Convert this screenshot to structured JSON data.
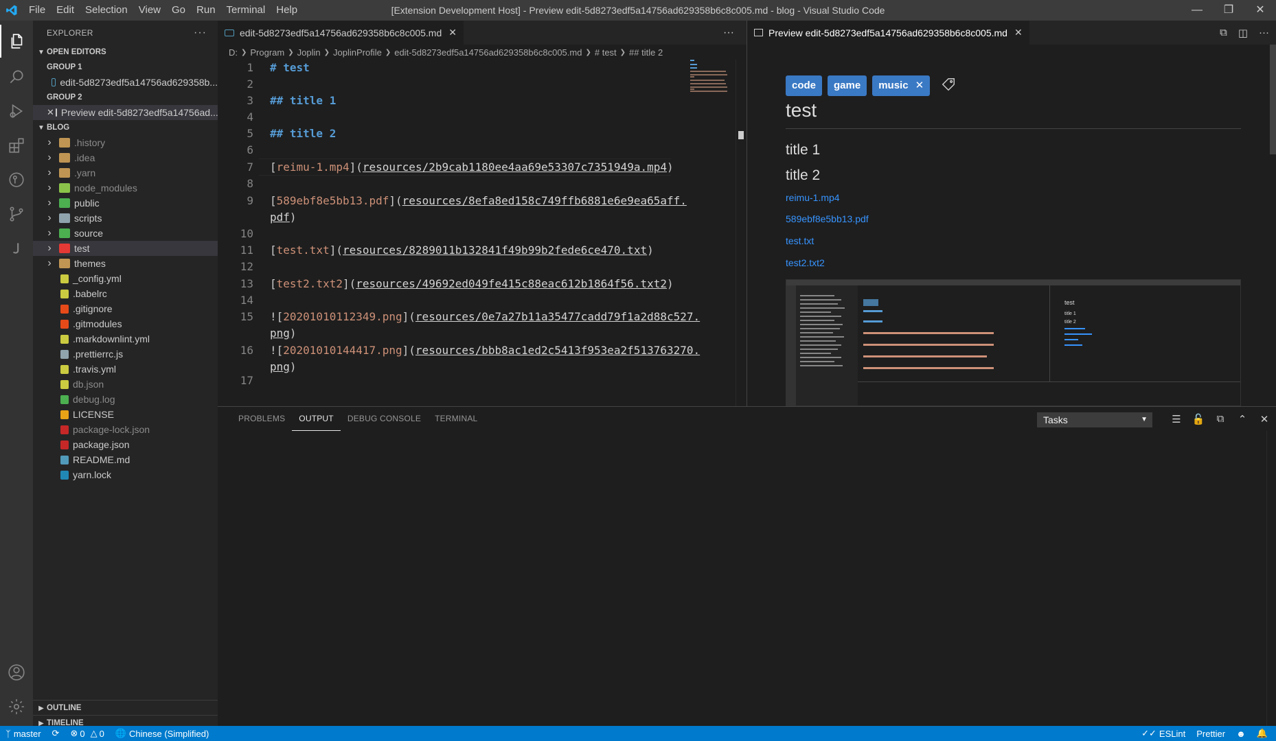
{
  "window": {
    "title": "[Extension Development Host] - Preview edit-5d8273edf5a14756ad629358b6c8c005.md - blog - Visual Studio Code",
    "menu": [
      "File",
      "Edit",
      "Selection",
      "View",
      "Go",
      "Run",
      "Terminal",
      "Help"
    ]
  },
  "sidebar": {
    "title": "EXPLORER",
    "open_editors": {
      "label": "OPEN EDITORS",
      "group1_label": "GROUP 1",
      "group1_item": "edit-5d8273edf5a14756ad629358b...",
      "group2_label": "GROUP 2",
      "group2_item": "Preview edit-5d8273edf5a14756ad..."
    },
    "folder_label": "BLOG",
    "tree": [
      {
        "name": ".history",
        "type": "folder",
        "color": "#c09553"
      },
      {
        "name": ".idea",
        "type": "folder",
        "color": "#c09553"
      },
      {
        "name": ".yarn",
        "type": "folder",
        "color": "#c09553"
      },
      {
        "name": "node_modules",
        "type": "folder",
        "color": "#8bc34a"
      },
      {
        "name": "public",
        "type": "folder",
        "color": "#4caf50"
      },
      {
        "name": "scripts",
        "type": "folder",
        "color": "#90a4ae"
      },
      {
        "name": "source",
        "type": "folder",
        "color": "#4caf50"
      },
      {
        "name": "test",
        "type": "folder",
        "color": "#e53935"
      },
      {
        "name": "themes",
        "type": "folder",
        "color": "#c09553"
      },
      {
        "name": "_config.yml",
        "type": "file",
        "color": "#cbcb41"
      },
      {
        "name": ".babelrc",
        "type": "file",
        "color": "#cbcb41"
      },
      {
        "name": ".gitignore",
        "type": "file",
        "color": "#e64a19"
      },
      {
        "name": ".gitmodules",
        "type": "file",
        "color": "#e64a19"
      },
      {
        "name": ".markdownlint.yml",
        "type": "file",
        "color": "#cbcb41"
      },
      {
        "name": ".prettierrc.js",
        "type": "file",
        "color": "#90a4ae"
      },
      {
        "name": ".travis.yml",
        "type": "file",
        "color": "#cbcb41"
      },
      {
        "name": "db.json",
        "type": "file",
        "color": "#cbcb41"
      },
      {
        "name": "debug.log",
        "type": "file",
        "color": "#4caf50"
      },
      {
        "name": "LICENSE",
        "type": "file",
        "color": "#e8a317"
      },
      {
        "name": "package-lock.json",
        "type": "file",
        "color": "#c62828"
      },
      {
        "name": "package.json",
        "type": "file",
        "color": "#c62828"
      },
      {
        "name": "README.md",
        "type": "file",
        "color": "#519aba"
      },
      {
        "name": "yarn.lock",
        "type": "file",
        "color": "#2188b6"
      }
    ],
    "outline_label": "OUTLINE",
    "timeline_label": "TIMELINE"
  },
  "editor": {
    "tab_label": "edit-5d8273edf5a14756ad629358b6c8c005.md",
    "breadcrumb": [
      "D:",
      "Program",
      "Joplin",
      "JoplinProfile",
      "edit-5d8273edf5a14756ad629358b6c8c005.md",
      "# test",
      "## title 2"
    ],
    "lines": [
      {
        "n": "1",
        "parts": [
          {
            "c": "h",
            "t": "# test"
          }
        ]
      },
      {
        "n": "2",
        "parts": []
      },
      {
        "n": "3",
        "parts": [
          {
            "c": "h",
            "t": "## title 1"
          }
        ]
      },
      {
        "n": "4",
        "parts": []
      },
      {
        "n": "5",
        "parts": [
          {
            "c": "h",
            "t": "## title 2"
          }
        ]
      },
      {
        "n": "6",
        "parts": []
      },
      {
        "n": "7",
        "parts": [
          {
            "c": "br",
            "t": "["
          },
          {
            "c": "lt",
            "t": "reimu-1.mp4"
          },
          {
            "c": "br",
            "t": "]("
          },
          {
            "c": "lk",
            "t": "resources/2b9cab1180ee4aa69e53307c7351949a.mp4"
          },
          {
            "c": "br",
            "t": ")"
          }
        ]
      },
      {
        "n": "8",
        "parts": []
      },
      {
        "n": "9",
        "parts": [
          {
            "c": "br",
            "t": "["
          },
          {
            "c": "lt",
            "t": "589ebf8e5bb13.pdf"
          },
          {
            "c": "br",
            "t": "]("
          },
          {
            "c": "lk",
            "t": "resources/8efa8ed158c749ffb6881e6e9ea65aff."
          }
        ]
      },
      {
        "n": "",
        "parts": [
          {
            "c": "lk",
            "t": "pdf"
          },
          {
            "c": "br",
            "t": ")"
          }
        ]
      },
      {
        "n": "10",
        "parts": []
      },
      {
        "n": "11",
        "parts": [
          {
            "c": "br",
            "t": "["
          },
          {
            "c": "lt",
            "t": "test.txt"
          },
          {
            "c": "br",
            "t": "]("
          },
          {
            "c": "lk",
            "t": "resources/8289011b132841f49b99b2fede6ce470.txt"
          },
          {
            "c": "br",
            "t": ")"
          }
        ]
      },
      {
        "n": "12",
        "parts": []
      },
      {
        "n": "13",
        "parts": [
          {
            "c": "br",
            "t": "["
          },
          {
            "c": "lt",
            "t": "test2.txt2"
          },
          {
            "c": "br",
            "t": "]("
          },
          {
            "c": "lk",
            "t": "resources/49692ed049fe415c88eac612b1864f56.txt2"
          },
          {
            "c": "br",
            "t": ")"
          }
        ]
      },
      {
        "n": "14",
        "parts": []
      },
      {
        "n": "15",
        "parts": [
          {
            "c": "br",
            "t": "!["
          },
          {
            "c": "lt",
            "t": "20201010112349.png"
          },
          {
            "c": "br",
            "t": "]("
          },
          {
            "c": "lk",
            "t": "resources/0e7a27b11a35477cadd79f1a2d88c527."
          }
        ]
      },
      {
        "n": "",
        "parts": [
          {
            "c": "lk",
            "t": "png"
          },
          {
            "c": "br",
            "t": ")"
          }
        ]
      },
      {
        "n": "16",
        "parts": [
          {
            "c": "br",
            "t": "!["
          },
          {
            "c": "lt",
            "t": "20201010144417.png"
          },
          {
            "c": "br",
            "t": "]("
          },
          {
            "c": "lk",
            "t": "resources/bbb8ac1ed2c5413f953ea2f513763270."
          }
        ]
      },
      {
        "n": "",
        "parts": [
          {
            "c": "lk",
            "t": "png"
          },
          {
            "c": "br",
            "t": ")"
          }
        ]
      },
      {
        "n": "17",
        "parts": []
      }
    ]
  },
  "preview": {
    "tab_label": "Preview edit-5d8273edf5a14756ad629358b6c8c005.md",
    "tags": [
      "code",
      "game",
      "music"
    ],
    "h1": "test",
    "h2a": "title 1",
    "h2b": "title 2",
    "links": [
      "reimu-1.mp4",
      "589ebf8e5bb13.pdf",
      "test.txt",
      "test2.txt2"
    ],
    "thumb": {
      "h1": "test",
      "items": [
        "title 1",
        "title 2"
      ]
    }
  },
  "panel": {
    "tabs": [
      "PROBLEMS",
      "OUTPUT",
      "DEBUG CONSOLE",
      "TERMINAL"
    ],
    "active_tab": "OUTPUT",
    "task_select": "Tasks"
  },
  "statusbar": {
    "branch": "master",
    "errors": "0",
    "warnings": "0",
    "language": "Chinese (Simplified)",
    "eslint": "ESLint",
    "prettier": "Prettier"
  },
  "colors": {
    "accent": "#007acc",
    "tag_bg": "#3a79c4",
    "link": "#3794ff"
  }
}
